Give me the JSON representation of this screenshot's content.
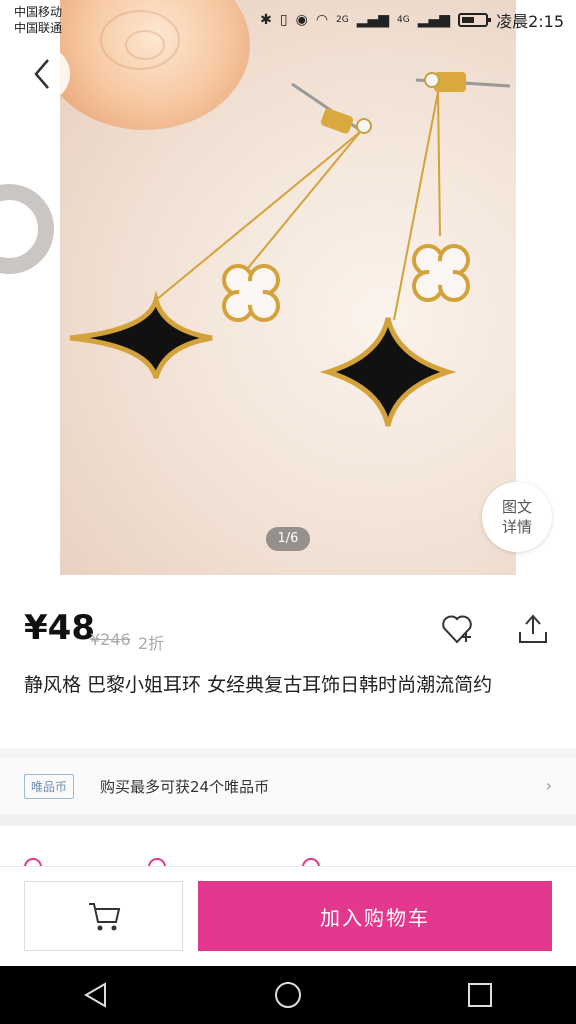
{
  "status_bar": {
    "carrier_1": "中国移动",
    "carrier_2": "中国联通",
    "network_1": "2G",
    "network_2": "4G",
    "time": "凌晨2:15"
  },
  "gallery": {
    "page_indicator": "1/6",
    "detail_button_line1": "图文",
    "detail_button_line2": "详情"
  },
  "product": {
    "price": "¥48",
    "original_price": "¥246",
    "discount": "2折",
    "title": "静风格 巴黎小姐耳环 女经典复古耳饰日韩时尚潮流简约"
  },
  "coin": {
    "badge": "唯品币",
    "text": "购买最多可获24个唯品币"
  },
  "actions": {
    "add_to_cart": "加入购物车"
  },
  "colors": {
    "accent": "#e2388d"
  }
}
